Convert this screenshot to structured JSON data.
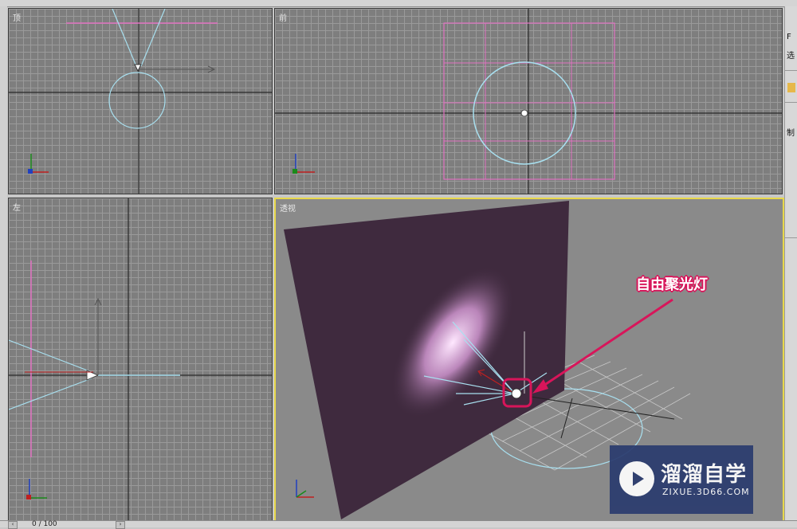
{
  "viewports": {
    "top": {
      "label": "顶"
    },
    "front": {
      "label": "前"
    },
    "left": {
      "label": "左"
    },
    "perspective": {
      "label": "透视"
    }
  },
  "annotation": {
    "label": "自由聚光灯"
  },
  "timeline": {
    "frame": "0 / 100",
    "prev_icon": "arrow-left-icon",
    "next_icon": "arrow-right-icon"
  },
  "right_panel": {
    "item1": "F",
    "item2": "选",
    "item3": "制"
  },
  "watermark": {
    "title": "溜溜自学",
    "subtitle": "ZIXUE.3D66.COM"
  },
  "colors": {
    "active_viewport_border": "#e8d84a",
    "annotation": "#d8155a",
    "light_cone": "#a8e0f0",
    "target_line": "#e070c0",
    "wall_plane": "#3f2a3e",
    "watermark_bg": "#2a3b6e"
  }
}
